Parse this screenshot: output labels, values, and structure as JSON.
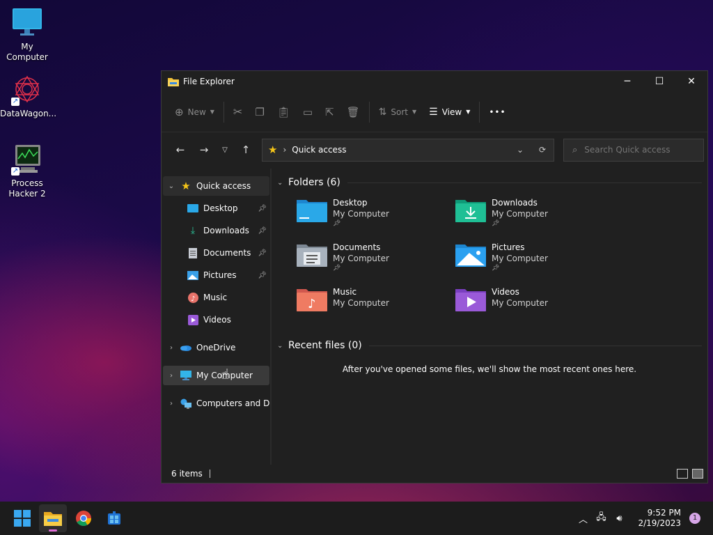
{
  "desktop": {
    "icons": [
      {
        "label": "My Computer",
        "icon": "monitor-icon"
      },
      {
        "label": "DataWagon...",
        "icon": "datawagon-icon"
      },
      {
        "label": "Process Hacker 2",
        "icon": "process-hacker-icon"
      }
    ]
  },
  "window": {
    "title": "File Explorer",
    "controls": {
      "minimize": "─",
      "maximize": "☐",
      "close": "✕"
    },
    "command_bar": {
      "new_label": "New",
      "sort_label": "Sort",
      "view_label": "View",
      "more_label": "•••"
    },
    "address": {
      "location": "Quick access",
      "search_placeholder": "Search Quick access"
    },
    "nav_pane": {
      "quick_access": "Quick access",
      "items": [
        {
          "label": "Desktop",
          "pinned": true
        },
        {
          "label": "Downloads",
          "pinned": true
        },
        {
          "label": "Documents",
          "pinned": true
        },
        {
          "label": "Pictures",
          "pinned": true
        },
        {
          "label": "Music",
          "pinned": false
        },
        {
          "label": "Videos",
          "pinned": false
        }
      ],
      "onedrive": "OneDrive",
      "my_computer": "My Computer",
      "network": "Computers and Dev"
    },
    "content": {
      "folders_header": "Folders (6)",
      "folders": [
        {
          "name": "Desktop",
          "location": "My Computer",
          "pinned": true
        },
        {
          "name": "Downloads",
          "location": "My Computer",
          "pinned": true
        },
        {
          "name": "Documents",
          "location": "My Computer",
          "pinned": true
        },
        {
          "name": "Pictures",
          "location": "My Computer",
          "pinned": true
        },
        {
          "name": "Music",
          "location": "My Computer",
          "pinned": false
        },
        {
          "name": "Videos",
          "location": "My Computer",
          "pinned": false
        }
      ],
      "recent_header": "Recent files (0)",
      "recent_message": "After you've opened some files, we'll show the most recent ones here."
    },
    "status": {
      "items_count": "6 items"
    }
  },
  "taskbar": {
    "time": "9:52 PM",
    "date": "2/19/2023",
    "notifications": "1"
  },
  "colors": {
    "accent": "#e06dd6",
    "window_bg": "#202020",
    "taskbar_bg": "#1c1c1c"
  }
}
